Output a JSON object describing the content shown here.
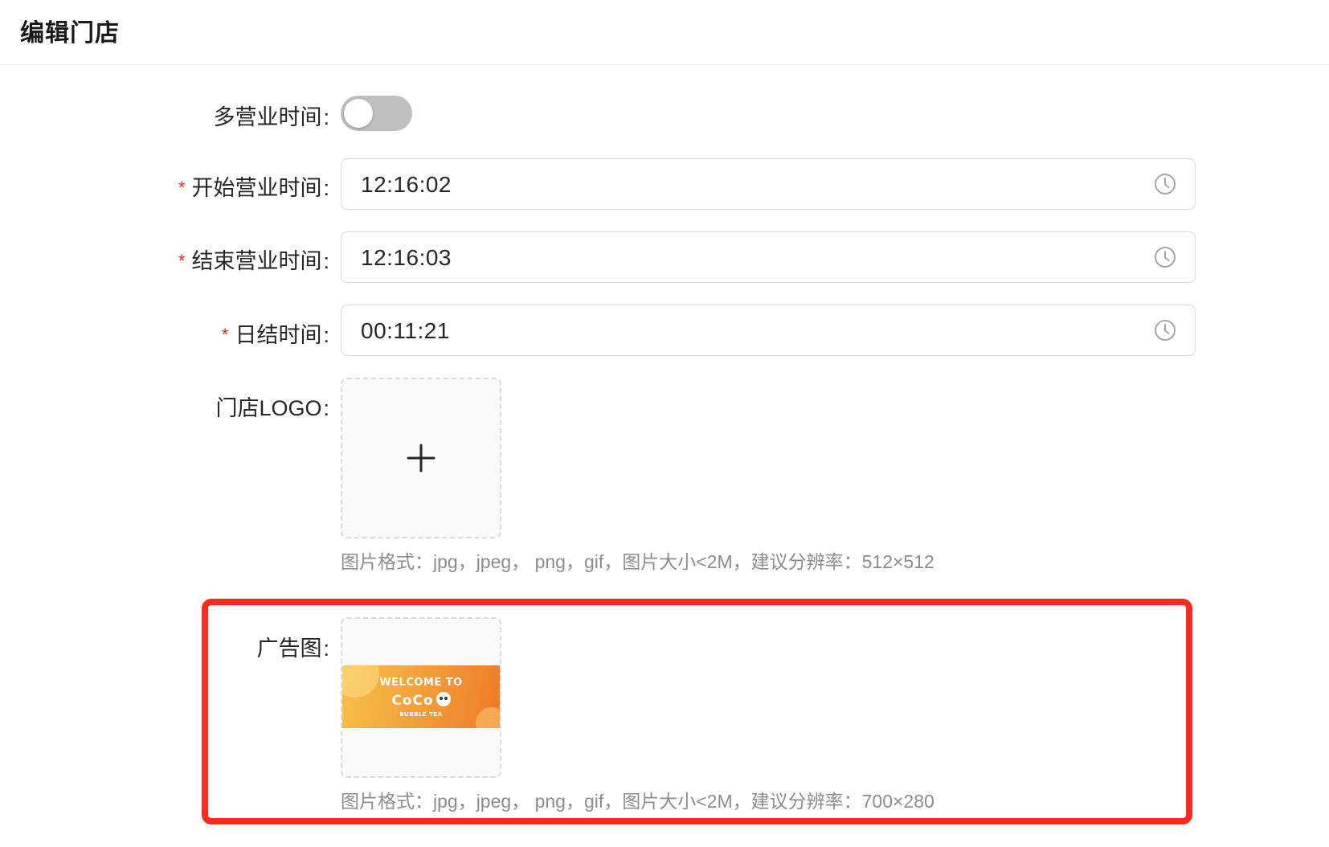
{
  "header": {
    "title": "编辑门店"
  },
  "form": {
    "multi_hours": {
      "label": "多营业时间",
      "colon": ":",
      "enabled": false
    },
    "start_time": {
      "required_mark": "*",
      "label": "开始营业时间",
      "colon": ":",
      "value": "12:16:02",
      "icon": "clock-icon"
    },
    "end_time": {
      "required_mark": "*",
      "label": "结束营业时间",
      "colon": ":",
      "value": "12:16:03",
      "icon": "clock-icon"
    },
    "settlement_time": {
      "required_mark": "*",
      "label": "日结时间",
      "colon": ":",
      "value": "00:11:21",
      "icon": "clock-icon"
    },
    "logo": {
      "label": "门店LOGO",
      "colon": ":",
      "icon": "plus-icon",
      "hint": "图片格式：jpg，jpeg， png，gif，图片大小<2M，建议分辨率：512×512"
    },
    "ad_image": {
      "label": "广告图",
      "colon": ":",
      "image_text": {
        "welcome": "WELCOME TO",
        "brand": "CoCo",
        "sub": "BUBBLE TEA"
      },
      "hint": "图片格式：jpg，jpeg， png，gif，图片大小<2M，建议分辨率：700×280"
    }
  },
  "colors": {
    "required": "#f5222d",
    "highlight": "#fe2a1e",
    "toggle_off": "#bfbfbf",
    "hint_text": "#8c8c8c",
    "input_border": "#d9d9d9"
  }
}
